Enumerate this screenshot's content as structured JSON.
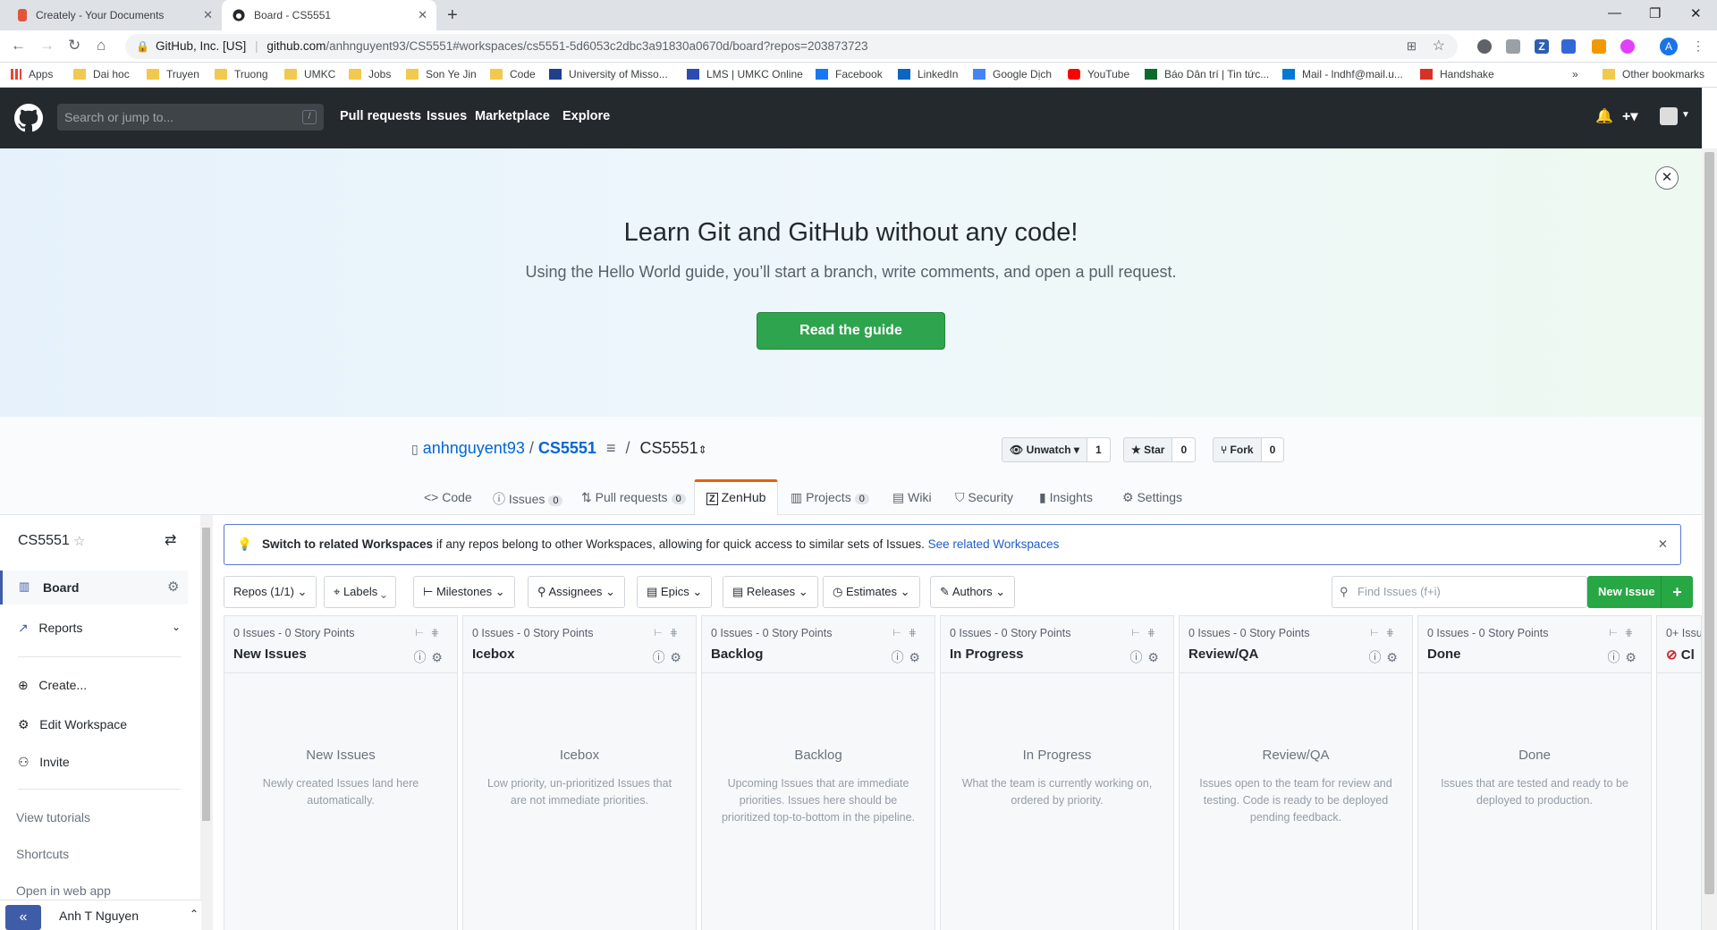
{
  "browser": {
    "tabs": [
      {
        "title": "Creately - Your Documents",
        "close": "✕"
      },
      {
        "title": "Board - CS5551",
        "close": "✕"
      }
    ],
    "new_tab": "+",
    "window_controls": {
      "minimize": "—",
      "maximize": "❐",
      "close": "✕"
    },
    "omnibox": {
      "site_identity": "GitHub, Inc. [US]",
      "url_host": "github.com",
      "url_path": "/anhnguyent93/CS5551#workspaces/cs5551-5d6053c2dbc3a91830a0670d/board?repos=203873723"
    },
    "profile_initial": "A",
    "bookmarks": [
      "Apps",
      "Dai hoc",
      "Truyen",
      "Truong",
      "UMKC",
      "Jobs",
      "Son Ye Jin",
      "Code",
      "University of Misso...",
      "LMS | UMKC Online",
      "Facebook",
      "LinkedIn",
      "Google Dịch",
      "YouTube",
      "Báo Dân trí | Tin tức...",
      "Mail - lndhf@mail.u...",
      "Handshake"
    ],
    "bookmarks_overflow": "»",
    "other_bookmarks": "Other bookmarks"
  },
  "github": {
    "search_placeholder": "Search or jump to...",
    "search_shortcut": "/",
    "nav": [
      "Pull requests",
      "Issues",
      "Marketplace",
      "Explore"
    ],
    "plus_menu": "+▾"
  },
  "banner": {
    "title": "Learn Git and GitHub without any code!",
    "subtitle": "Using the Hello World guide, you’ll start a branch, write comments, and open a pull request.",
    "button": "Read the guide",
    "close": "✕"
  },
  "repo": {
    "owner": "anhnguyent93",
    "separator": "/",
    "name": "CS5551",
    "workspace_separator": "/",
    "workspace": "CS5551",
    "workspace_caret": "⇕",
    "unwatch": {
      "label": "Unwatch ▾",
      "count": "1"
    },
    "star": {
      "label": "Star",
      "count": "0"
    },
    "fork": {
      "label": "Fork",
      "count": "0"
    },
    "tabs": [
      {
        "label": "Code",
        "count": ""
      },
      {
        "label": "Issues",
        "count": "0"
      },
      {
        "label": "Pull requests",
        "count": "0"
      },
      {
        "label": "ZenHub",
        "count": ""
      },
      {
        "label": "Projects",
        "count": "0"
      },
      {
        "label": "Wiki",
        "count": ""
      },
      {
        "label": "Security",
        "count": ""
      },
      {
        "label": "Insights",
        "count": ""
      },
      {
        "label": "Settings",
        "count": ""
      }
    ]
  },
  "sidebar": {
    "workspace_name": "CS5551",
    "items": [
      {
        "label": "Board"
      },
      {
        "label": "Reports"
      },
      {
        "label": "Create..."
      },
      {
        "label": "Edit Workspace"
      },
      {
        "label": "Invite"
      }
    ],
    "links": [
      "View tutorials",
      "Shortcuts",
      "Open in web app"
    ],
    "user": "Anh T Nguyen",
    "collapse": "«"
  },
  "notice": {
    "bold": "Switch to related Workspaces",
    "text": " if any repos belong to other Workspaces, allowing for quick access to similar sets of Issues. ",
    "link": "See related Workspaces",
    "close": "✕"
  },
  "filters": [
    "Repos (1/1)",
    "Labels",
    "Milestones",
    "Assignees",
    "Epics",
    "Releases",
    "Estimates",
    "Authors"
  ],
  "find_placeholder": "Find Issues (f+i)",
  "new_issue": "New Issue",
  "columns": [
    {
      "meta": "0 Issues - 0 Story Points",
      "name": "New Issues",
      "empty_title": "New Issues",
      "empty_desc": "Newly created Issues land here automatically."
    },
    {
      "meta": "0 Issues - 0 Story Points",
      "name": "Icebox",
      "empty_title": "Icebox",
      "empty_desc": "Low priority, un-prioritized Issues that are not immediate priorities."
    },
    {
      "meta": "0 Issues - 0 Story Points",
      "name": "Backlog",
      "empty_title": "Backlog",
      "empty_desc": "Upcoming Issues that are immediate priorities. Issues here should be prioritized top-to-bottom in the pipeline."
    },
    {
      "meta": "0 Issues - 0 Story Points",
      "name": "In Progress",
      "empty_title": "In Progress",
      "empty_desc": "What the team is currently working on, ordered by priority."
    },
    {
      "meta": "0 Issues - 0 Story Points",
      "name": "Review/QA",
      "empty_title": "Review/QA",
      "empty_desc": "Issues open to the team for review and testing. Code is ready to be deployed pending feedback."
    },
    {
      "meta": "0 Issues - 0 Story Points",
      "name": "Done",
      "empty_title": "Done",
      "empty_desc": "Issues that are tested and ready to be deployed to production."
    }
  ],
  "closed_column": {
    "meta": "0+ Issu",
    "name": "Cl"
  },
  "colors": {
    "github_dark": "#24292e",
    "green": "#2ea44f",
    "link": "#0366d6",
    "zenhub_accent": "#e36209"
  }
}
